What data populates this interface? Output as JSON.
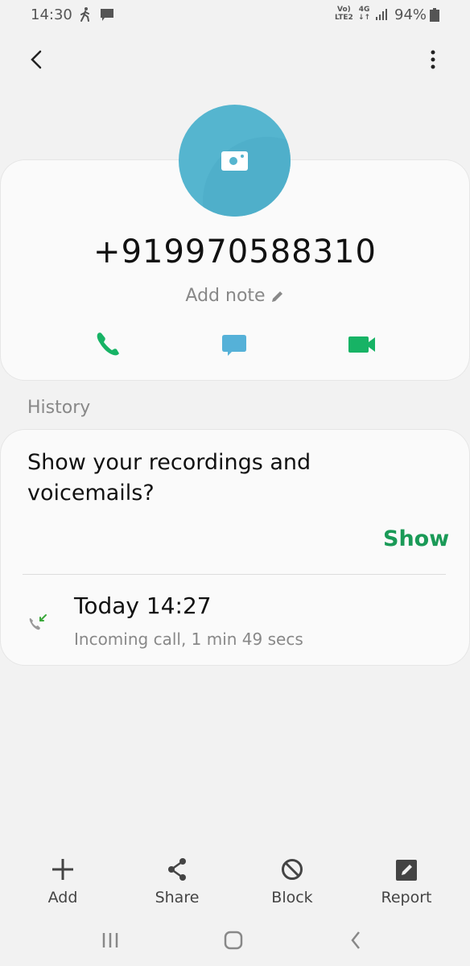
{
  "status_bar": {
    "time": "14:30",
    "volte_top": "Vo)",
    "volte_bottom": "LTE2",
    "network_type": "4G",
    "battery_percent": "94%",
    "icons": [
      "walking-icon",
      "message-icon",
      "signal-icon",
      "battery-icon"
    ]
  },
  "top_bar": {
    "back_icon": "back-arrow-icon",
    "more_icon": "more-options-icon"
  },
  "contact": {
    "avatar_icon": "camera-icon",
    "avatar_color": "#55b5cf",
    "phone_number": "+919970588310",
    "add_note_label": "Add note",
    "actions": [
      {
        "name": "voice-call",
        "icon": "phone-icon",
        "color": "#17b365"
      },
      {
        "name": "message",
        "icon": "chat-bubble-icon",
        "color": "#55b1d8"
      },
      {
        "name": "video-call",
        "icon": "video-camera-icon",
        "color": "#17b365"
      }
    ]
  },
  "history": {
    "section_label": "History",
    "prompt_text": "Show your recordings and voicemails?",
    "show_label": "Show",
    "show_color": "#1a9a57",
    "entries": [
      {
        "icon": "incoming-call-icon",
        "time": "Today 14:27",
        "detail": "Incoming call, 1 min 49 secs"
      }
    ]
  },
  "bottom_actions": [
    {
      "label": "Add",
      "icon": "plus-icon"
    },
    {
      "label": "Share",
      "icon": "share-icon"
    },
    {
      "label": "Block",
      "icon": "block-icon"
    },
    {
      "label": "Report",
      "icon": "report-icon"
    }
  ],
  "nav_bar": {
    "recent_icon": "recent-apps-icon",
    "home_icon": "home-icon",
    "back_icon": "nav-back-icon"
  }
}
